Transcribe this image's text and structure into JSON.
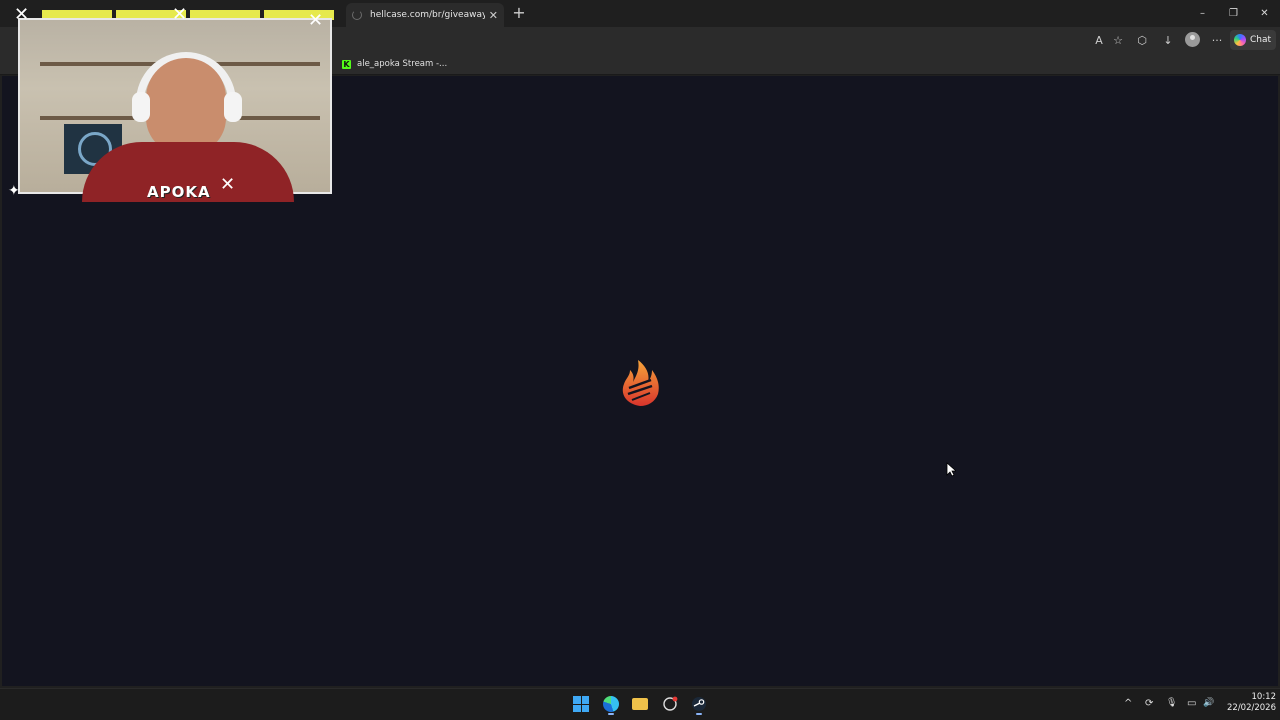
{
  "browser": {
    "tab": {
      "title": "hellcase.com/br/giveaways/user/d",
      "close": "✕"
    },
    "new_tab": "+",
    "window_controls": {
      "minimize": "–",
      "maximize": "❐",
      "close": "✕"
    },
    "toolbar": {
      "read_aloud_icon": "A",
      "favorite_icon": "☆",
      "extensions_icon": "⬡",
      "downloads_icon": "↓",
      "more_icon": "···",
      "chat_label": "Chat"
    },
    "favorites": [
      {
        "icon_letter": "K",
        "label": "ale_apoka Stream -..."
      }
    ]
  },
  "webcam": {
    "overlay_text": "APOKA"
  },
  "page": {
    "background": "#13141f",
    "loader_logo": "flame-logo"
  },
  "taskbar": {
    "tray": {
      "chevron": "^",
      "sync": "⟳",
      "mic": "🎙",
      "display": "▭",
      "volume": "🔊"
    },
    "clock": {
      "time": "10:12",
      "date": "22/02/2026"
    }
  }
}
